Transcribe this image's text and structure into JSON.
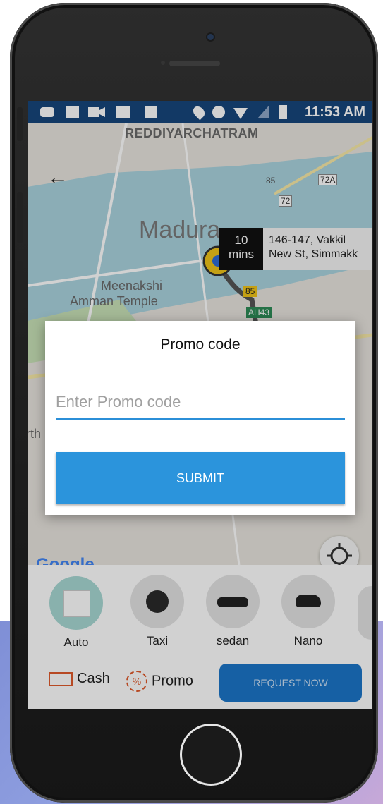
{
  "status_bar": {
    "time": "11:53 AM"
  },
  "map": {
    "area_labels": [
      "REDDIYARCHATRAM",
      "Madura",
      "Meenakshi",
      "Amman Temple"
    ],
    "road_badges": [
      "85",
      "72A",
      "72",
      "85",
      "AH43"
    ],
    "eta_value": "10",
    "eta_unit": "mins",
    "address_line1": "146-147, Vakkil",
    "address_line2": "New St, Simmakk",
    "google_logo": "Google",
    "side_label": "rth"
  },
  "promo_dialog": {
    "title": "Promo code",
    "input_placeholder": "Enter Promo code",
    "input_value": "",
    "submit_label": "SUBMIT"
  },
  "vehicles": [
    {
      "label": "Auto",
      "selected": true
    },
    {
      "label": "Taxi",
      "selected": false
    },
    {
      "label": "sedan",
      "selected": false
    },
    {
      "label": "Nano",
      "selected": false
    }
  ],
  "payment": {
    "cash_label": "Cash",
    "promo_label": "Promo"
  },
  "request_button": "REQUEST NOW",
  "colors": {
    "status_bar": "#16467c",
    "accent_blue": "#2b94dc",
    "request_blue": "#1b76c8",
    "eta_box": "#111111"
  }
}
